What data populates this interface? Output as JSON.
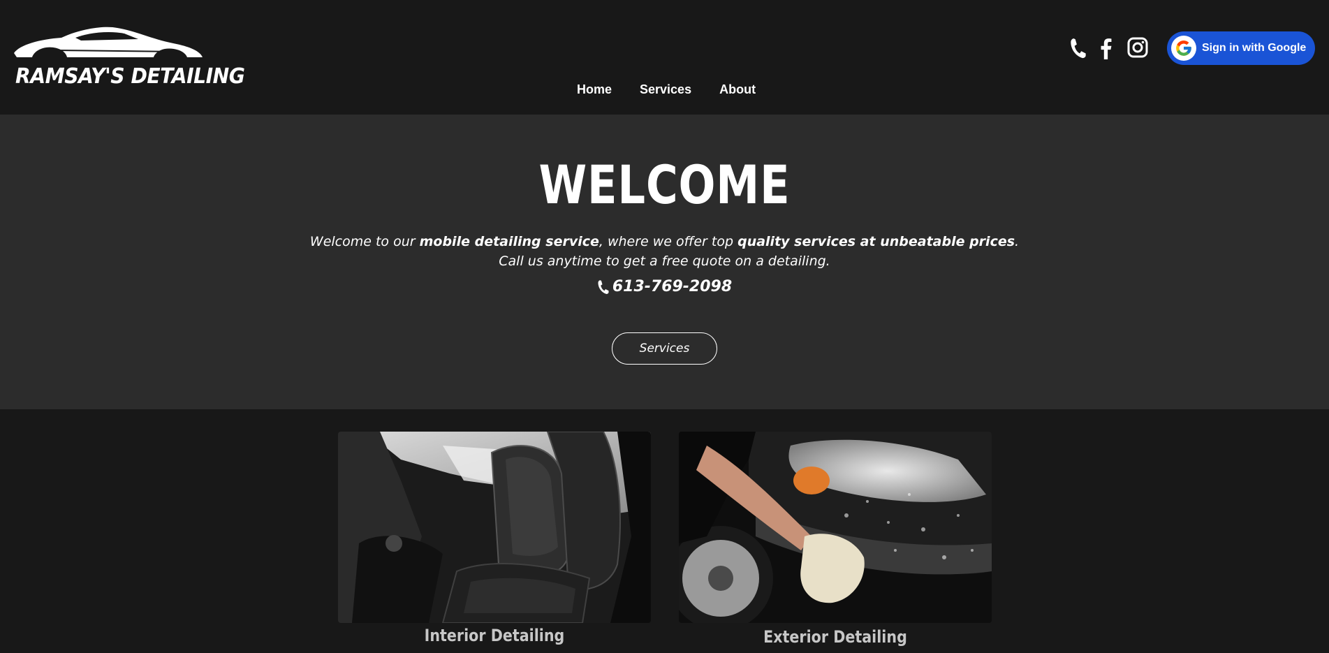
{
  "brand": {
    "name": "RAMSAY'S DETAILING",
    "logo_icon": "car-silhouette-icon"
  },
  "nav": {
    "items": [
      {
        "label": "Home"
      },
      {
        "label": "Services"
      },
      {
        "label": "About"
      }
    ]
  },
  "header": {
    "social": [
      {
        "name": "phone-icon"
      },
      {
        "name": "facebook-icon"
      },
      {
        "name": "instagram-icon"
      }
    ],
    "google_button": {
      "label": "Sign in with Google",
      "icon": "google-icon",
      "color": "#1a54d6"
    }
  },
  "hero": {
    "title": "WELCOME",
    "text_1": "Welcome to our ",
    "text_bold_1": "mobile detailing service",
    "text_2": ", where we offer top ",
    "text_bold_2": "quality services at unbeatable prices",
    "text_3": ".",
    "line_2": "Call us anytime to get a free quote on a detailing.",
    "phone": "613-769-2098",
    "button_label": "Services"
  },
  "services": [
    {
      "label": "Interior Detailing",
      "image": "car-interior-seats-photo"
    },
    {
      "label": "Exterior Detailing",
      "image": "car-exterior-washing-photo"
    }
  ],
  "colors": {
    "header_bg": "#181818",
    "hero_bg": "#2c2c2c",
    "page_bg": "#181818",
    "accent": "#1a54d6"
  }
}
